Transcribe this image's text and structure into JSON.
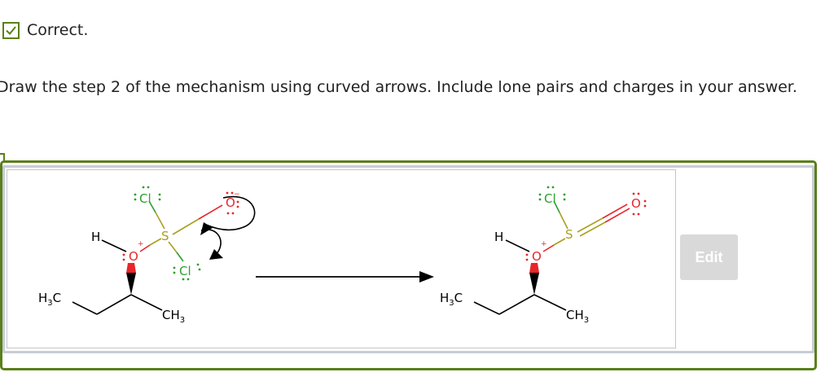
{
  "status": {
    "icon": "checkmark-icon",
    "text": "Correct.",
    "color": "#5b7f1a"
  },
  "question": {
    "text": "Draw the step 2 of the mechanism using curved arrows. Include lone pairs and charges in your answer."
  },
  "answer": {
    "edit_label": "Edit",
    "reactant": {
      "atoms": {
        "h": "H",
        "o": "O",
        "s": "S",
        "cl_top": "Cl",
        "cl_bottom": "Cl",
        "o_minus": "O",
        "h3c": "H",
        "h3c_sub": "3",
        "h3c_c": "C",
        "ch3_c": "CH",
        "ch3_sub": "3",
        "o_charge": "+",
        "o_minus_charge": "−"
      }
    },
    "product": {
      "atoms": {
        "h": "H",
        "o": "O",
        "s": "S",
        "cl": "Cl",
        "o_double": "O",
        "h3c": "H",
        "h3c_sub": "3",
        "h3c_c": "C",
        "ch3_c": "CH",
        "ch3_sub": "3",
        "o_charge": "+"
      }
    },
    "colors": {
      "oxygen": "#e8262a",
      "chlorine": "#2ca02c",
      "sulfur": "#a8a020",
      "bond": "#000000"
    }
  }
}
